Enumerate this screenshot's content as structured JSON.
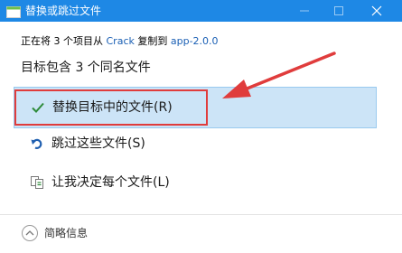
{
  "window": {
    "title": "替换或跳过文件",
    "titlebar_color": "#1e88e5",
    "controls": [
      "minimize",
      "maximize",
      "close"
    ]
  },
  "info": {
    "prefix": "正在将 3 个项目从",
    "source": "Crack",
    "middle": "复制到",
    "destination": "app-2.0.0"
  },
  "heading": "目标包含 3 个同名文件",
  "options": {
    "replace": {
      "label": "替换目标中的文件(R)",
      "icon": "check-icon",
      "selected": true
    },
    "skip": {
      "label": "跳过这些文件(S)",
      "icon": "skip-icon"
    },
    "decide": {
      "label": "让我决定每个文件(L)",
      "icon": "compare-files-icon"
    }
  },
  "annotation": {
    "color": "#e03c3c"
  },
  "footer": {
    "label": "简略信息",
    "icon": "chevron-up-icon"
  }
}
